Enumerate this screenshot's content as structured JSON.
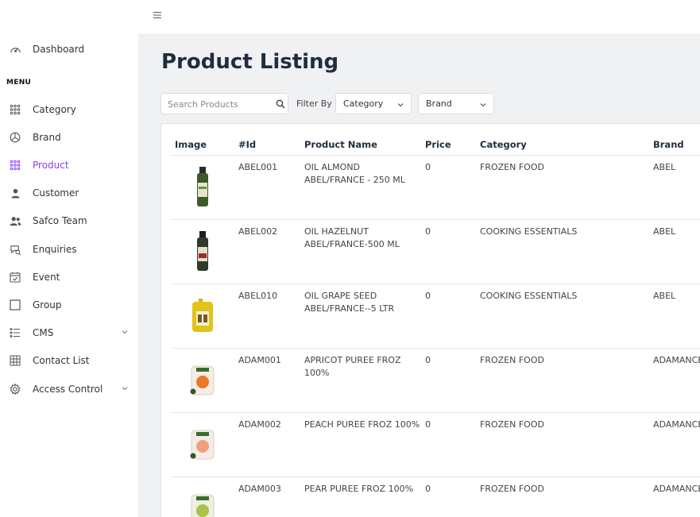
{
  "sidebar": {
    "dashboard": "Dashboard",
    "menu_heading": "MENU",
    "items": [
      {
        "label": "Category",
        "icon": "grid-dots-icon"
      },
      {
        "label": "Brand",
        "icon": "pie-chart-icon"
      },
      {
        "label": "Product",
        "icon": "grid-dots-icon",
        "active": true
      },
      {
        "label": "Customer",
        "icon": "user-icon"
      },
      {
        "label": "Safco Team",
        "icon": "users-icon"
      },
      {
        "label": "Enquiries",
        "icon": "chat-search-icon"
      },
      {
        "label": "Event",
        "icon": "calendar-check-icon"
      },
      {
        "label": "Group",
        "icon": "square-icon"
      },
      {
        "label": "CMS",
        "icon": "list-icon",
        "has_submenu": true
      },
      {
        "label": "Contact List",
        "icon": "table-grid-icon"
      },
      {
        "label": "Access Control",
        "icon": "gear-icon",
        "has_submenu": true
      }
    ]
  },
  "main": {
    "title": "Product Listing",
    "search_placeholder": "Search Products",
    "filter_label": "Filter By",
    "category_select": "Category",
    "brand_select": "Brand"
  },
  "table": {
    "headers": {
      "image": "Image",
      "id": "#Id",
      "name": "Product Name",
      "price": "Price",
      "category": "Category",
      "brand": "Brand"
    },
    "rows": [
      {
        "id": "ABEL001",
        "name": "OIL ALMOND ABEL/FRANCE - 250 ML",
        "price": "0",
        "category": "FROZEN FOOD",
        "brand": "ABEL",
        "image": "tall-oil-bottle"
      },
      {
        "id": "ABEL002",
        "name": "OIL HAZELNUT ABEL/FRANCE-500 ML",
        "price": "0",
        "category": "COOKING ESSENTIALS",
        "brand": "ABEL",
        "image": "dark-oil-bottle"
      },
      {
        "id": "ABEL010",
        "name": "OIL GRAPE SEED ABEL/FRANCE--5 LTR",
        "price": "0",
        "category": "COOKING ESSENTIALS",
        "brand": "ABEL",
        "image": "oil-jerrycan"
      },
      {
        "id": "ADAM001",
        "name": "APRICOT PUREE FROZ 100%",
        "price": "0",
        "category": "FROZEN FOOD",
        "brand": "ADAMANCE",
        "image": "puree-tub-orange"
      },
      {
        "id": "ADAM002",
        "name": "PEACH PUREE FROZ 100%",
        "price": "0",
        "category": "FROZEN FOOD",
        "brand": "ADAMANCE",
        "image": "puree-tub-peach"
      },
      {
        "id": "ADAM003",
        "name": "PEAR PUREE FROZ 100%",
        "price": "0",
        "category": "FROZEN FOOD",
        "brand": "ADAMANCE",
        "image": "puree-tub-green"
      }
    ]
  },
  "colors": {
    "accent": "#8b3df0",
    "main_bg": "#f0f1f3",
    "title": "#1f2d3d"
  }
}
